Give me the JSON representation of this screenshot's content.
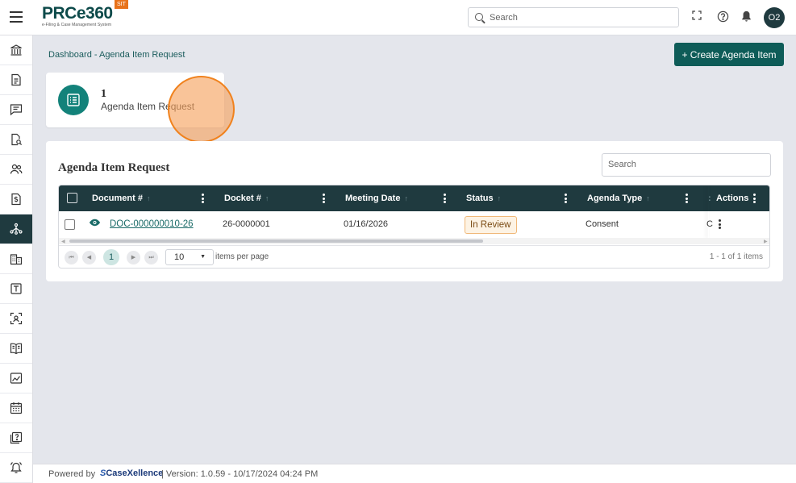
{
  "header": {
    "logo_text": "PRCe360",
    "logo_subtitle": "e-Filing & Case Management System",
    "env_badge": "SIT",
    "search_placeholder": "Search",
    "icons": [
      "menu-icon",
      "fullscreen-icon",
      "help-icon",
      "bell-icon"
    ],
    "avatar_initials": "O2"
  },
  "sidebar": {
    "items": [
      {
        "icon": "bank-icon",
        "active": false
      },
      {
        "icon": "document-icon",
        "active": false
      },
      {
        "icon": "chat-icon",
        "active": false
      },
      {
        "icon": "document-search-icon",
        "active": false
      },
      {
        "icon": "users-icon",
        "active": false
      },
      {
        "icon": "dollar-document-icon",
        "active": false
      },
      {
        "icon": "workflow-icon",
        "active": true
      },
      {
        "icon": "building-icon",
        "active": false
      },
      {
        "icon": "template-icon",
        "active": false
      },
      {
        "icon": "scan-user-icon",
        "active": false
      },
      {
        "icon": "book-icon",
        "active": false
      },
      {
        "icon": "chart-icon",
        "active": false
      },
      {
        "icon": "calendar-icon",
        "active": false
      },
      {
        "icon": "help-book-icon",
        "active": false
      },
      {
        "icon": "alarm-icon",
        "active": false
      }
    ]
  },
  "page": {
    "breadcrumb": "Dashboard - Agenda Item Request",
    "create_button": "+ Create Agenda Item"
  },
  "stat": {
    "count": "1",
    "label": "Agenda Item Request"
  },
  "table": {
    "title": "Agenda Item Request",
    "search_placeholder": "Search",
    "columns": [
      "Document #",
      "Docket #",
      "Meeting Date",
      "Status",
      "Agenda Type",
      "Actions"
    ],
    "rows": [
      {
        "document": "DOC-000000010-26",
        "docket": "26-0000001",
        "meeting_date": "01/16/2026",
        "status": "In Review",
        "agenda_type": "Consent"
      }
    ],
    "pager": {
      "current_page": "1",
      "page_size": "10",
      "page_size_label": "items per page",
      "info": "1 - 1 of 1 items"
    }
  },
  "footer": {
    "powered_by": "Powered by",
    "brand": "CaseXellence",
    "version": "|   Version: 1.0.59 - 10/17/2024 04:24 PM"
  },
  "colors": {
    "primary_dark": "#1f3a3f",
    "accent_teal": "#0e5c58",
    "status_review_bg": "#fdf3e4",
    "status_review_border": "#f0b878",
    "brand_orange": "#e8731b"
  }
}
